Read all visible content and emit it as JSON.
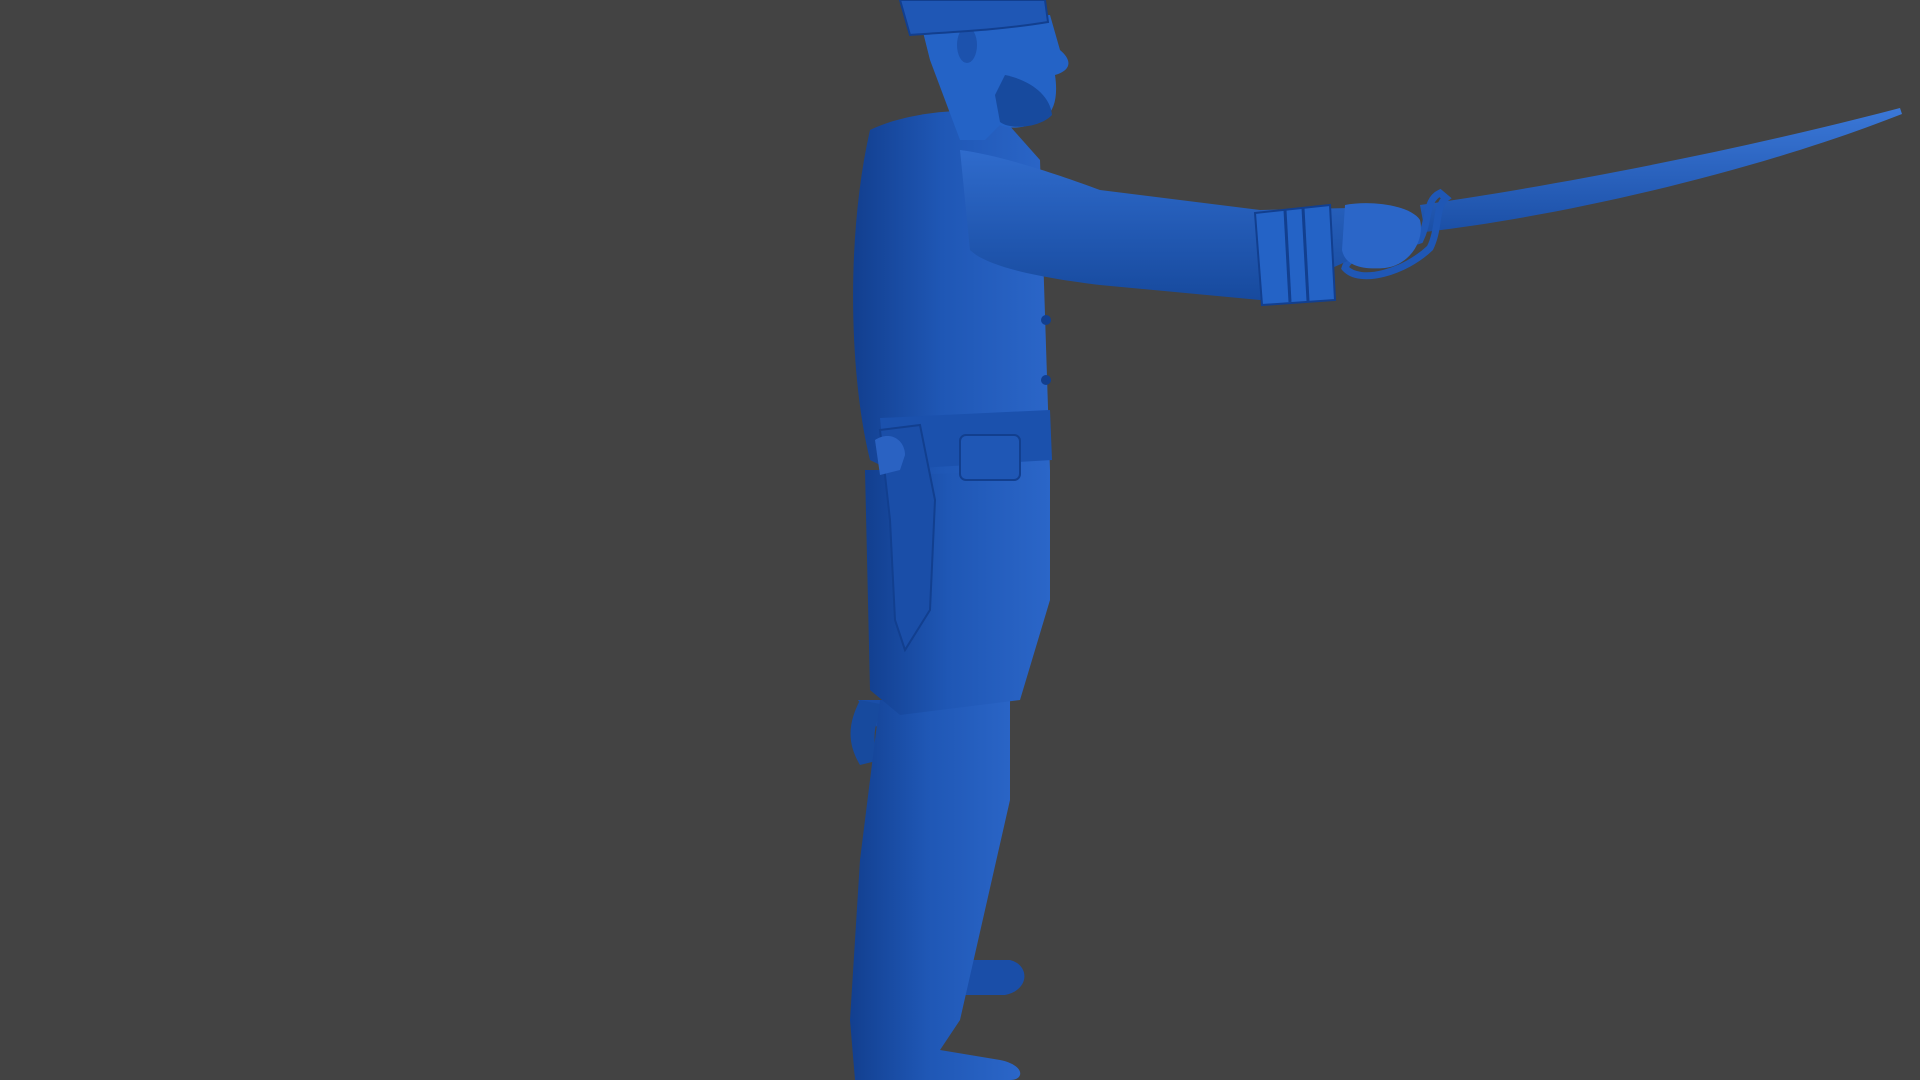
{
  "viewport": {
    "background_color": "#434343"
  },
  "model": {
    "subject": "soldier-figure",
    "material_color": "#1f57b5",
    "shade_color": "#123f8f",
    "highlight_color": "#3b78d8",
    "accessories": [
      "cap-icon",
      "sabre-icon",
      "revolver-holster-icon",
      "belt-icon",
      "scabbard-icon",
      "boots-icon"
    ]
  }
}
